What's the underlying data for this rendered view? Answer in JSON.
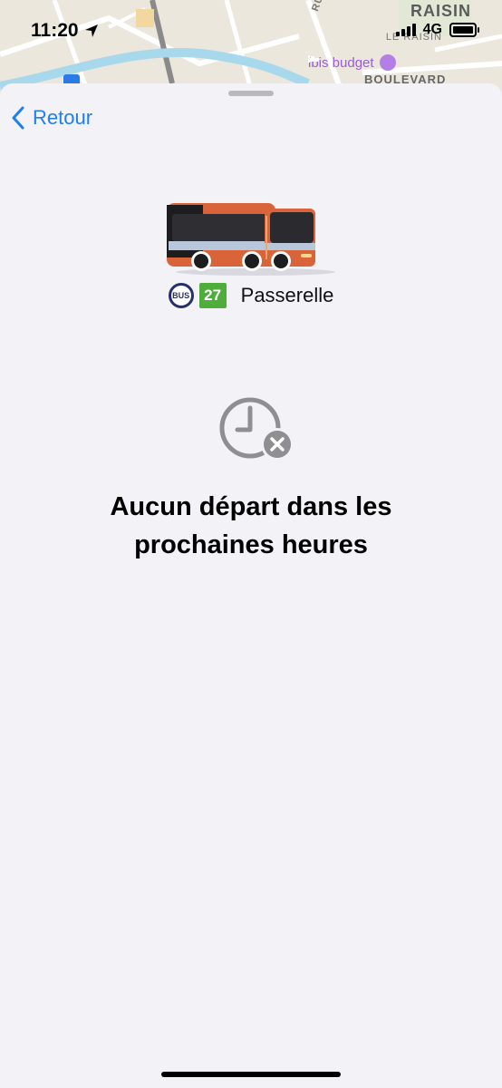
{
  "status_bar": {
    "time": "11:20",
    "network": "4G",
    "icons": [
      "location-arrow-icon",
      "signal-icon",
      "battery-icon"
    ]
  },
  "map": {
    "labels": {
      "raisin": "RAISIN",
      "le_raisin": "LE RAISIN",
      "rue": "RUE PIERR",
      "boulevard": "BOULEVARD"
    },
    "poi": {
      "name": "ibis budget",
      "icon": "bed-icon",
      "color": "#9a5cd8"
    }
  },
  "sheet": {
    "back_label": "Retour",
    "route": {
      "mode_badge": "BUS",
      "line_number": "27",
      "line_color": "#4fae3b",
      "stop_name": "Passerelle"
    },
    "empty_state": {
      "icon": "clock-cancel-icon",
      "title": "Aucun départ dans les prochaines heures"
    }
  },
  "colors": {
    "accent": "#1e7ff2",
    "sheet_background": "#f2f2f7"
  }
}
